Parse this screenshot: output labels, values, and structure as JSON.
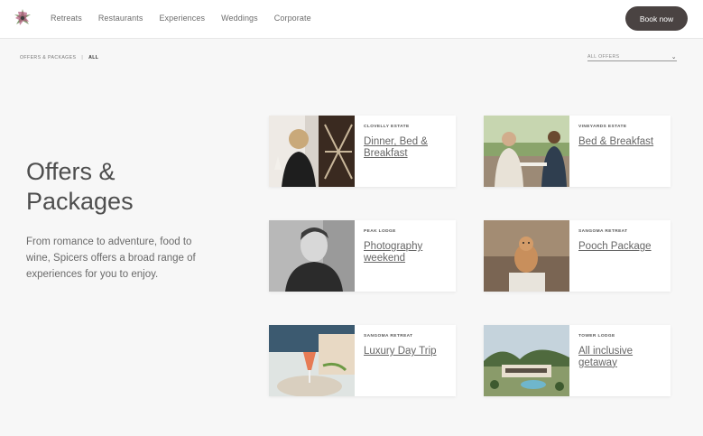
{
  "header": {
    "nav": [
      "Retreats",
      "Restaurants",
      "Experiences",
      "Weddings",
      "Corporate"
    ],
    "book_label": "Book now"
  },
  "breadcrumb": {
    "parent": "OFFERS & PACKAGES",
    "separator": "|",
    "current": "ALL"
  },
  "filter": {
    "selected": "ALL OFFERS"
  },
  "main": {
    "title": "Offers & Packages",
    "intro": "From romance to adventure, food to wine, Spicers offers a broad range of experiences for you to enjoy."
  },
  "offers": [
    {
      "location": "CLOVELLY ESTATE",
      "name": "Dinner, Bed & Breakfast"
    },
    {
      "location": "VINEYARDS ESTATE",
      "name": "Bed & Breakfast"
    },
    {
      "location": "PEAK LODGE",
      "name": "Photography weekend"
    },
    {
      "location": "SANGOMA RETREAT",
      "name": "Pooch Package"
    },
    {
      "location": "SANGOMA RETREAT",
      "name": "Luxury Day Trip"
    },
    {
      "location": "TOWER LODGE",
      "name": "All inclusive getaway"
    }
  ]
}
